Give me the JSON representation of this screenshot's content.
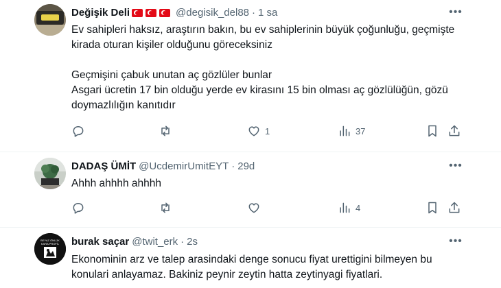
{
  "tweets": [
    {
      "name": "Değişik Deli",
      "flags": [
        "turkish-flag",
        "turkish-flag",
        "turkish-flag"
      ],
      "handle": "@degisik_del88",
      "separator": "·",
      "time": "1 sa",
      "text": "Ev sahipleri haksız, araştırın bakın,  bu ev sahiplerinin büyük çoğunluğu, geçmişte kirada oturan kişiler olduğunu göreceksiniz\n\nGeçmişini çabuk unutan aç gözlüler bunlar\nAsgari ücretin 17 bin olduğu yerde ev kirasını 15 bin olması aç gözlülüğün, gözü doymazlılığın kanıtıdır",
      "replies": "",
      "reposts": "",
      "likes": "1",
      "views": "37"
    },
    {
      "name": "DADAŞ ÜMİT",
      "handle": "@UcdemirUmitEYT",
      "separator": "·",
      "time": "29d",
      "text": "Ahhh ahhhh ahhhh",
      "replies": "",
      "reposts": "",
      "likes": "",
      "views": "4"
    },
    {
      "name": "burak saçar",
      "handle": "@twit_erk",
      "separator": "·",
      "time": "2s",
      "text": "Ekonominin arz ve talep arasindaki denge sonucu fiyat urettigini bilmeyen bu konulari anlayamaz. Bakiniz peynir zeytin hatta zeytinyagi fiyatlari.",
      "avatar_text": "BEYAZ ÖNLÜK KARA PROFİL"
    }
  ],
  "more_icon": "more-horizontal-icon",
  "colors": {
    "text": "#0f1419",
    "secondary": "#536471",
    "divider": "#eff3f4",
    "flag_red": "#e30a17"
  }
}
